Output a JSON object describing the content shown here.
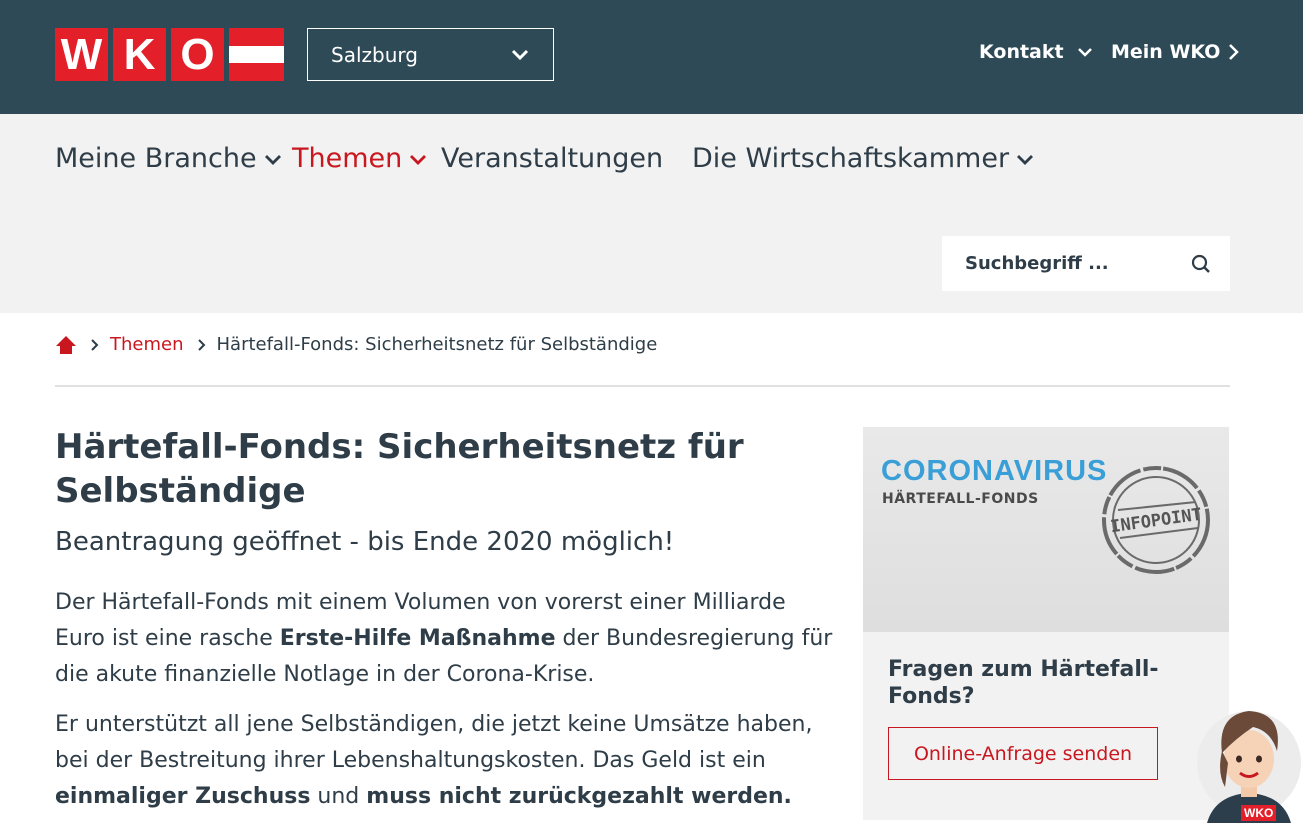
{
  "header": {
    "logo_letters": [
      "W",
      "K",
      "O"
    ],
    "region": "Salzburg",
    "links": [
      {
        "label": "Kontakt"
      },
      {
        "label": "Mein WKO"
      }
    ]
  },
  "nav": {
    "items": [
      {
        "label": "Meine Branche",
        "active": false
      },
      {
        "label": "Themen",
        "active": true
      },
      {
        "label": "Veranstaltungen",
        "active": false
      },
      {
        "label": "Die Wirtschaftskammer",
        "active": false
      }
    ],
    "search_placeholder": "Suchbegriff ..."
  },
  "breadcrumb": {
    "home_icon": "home-icon",
    "items": [
      "Themen",
      "Härtefall-Fonds: Sicherheitsnetz für Selbständige"
    ]
  },
  "article": {
    "title": "Härtefall-Fonds: Sicherheitsnetz für Selbständige",
    "subtitle": "Beantragung geöffnet - bis Ende 2020 möglich!",
    "p1": {
      "a": "Der Härtefall-Fonds mit einem Volumen von vorerst einer Milliarde Euro ist eine rasche ",
      "b": "Erste-Hilfe Maßnahme",
      "c": " der Bundesregierung für die akute finanzielle Notlage in der Corona-Krise."
    },
    "p2": {
      "a": "Er unterstützt all jene Selbständigen, die jetzt keine Umsätze haben, bei der Bestreitung ihrer Lebenshaltungskosten. Das Geld ist ein ",
      "b": "einmaliger Zuschuss",
      "c": " und ",
      "d": "muss nicht zurückgezahlt werden."
    }
  },
  "sidebar": {
    "image_title": "CORONAVIRUS",
    "image_subtitle": "HÄRTEFALL-FONDS",
    "stamp_text": "INFOPOINT",
    "question": "Fragen zum Härtefall-Fonds?",
    "button": "Online-Anfrage senden"
  },
  "chat": {
    "badge": "WKO"
  },
  "colors": {
    "topbar": "#2e4a57",
    "brand_red": "#e3202a",
    "link_red": "#c8171f",
    "nav_bg": "#f2f2f2",
    "text": "#2e3d47"
  }
}
